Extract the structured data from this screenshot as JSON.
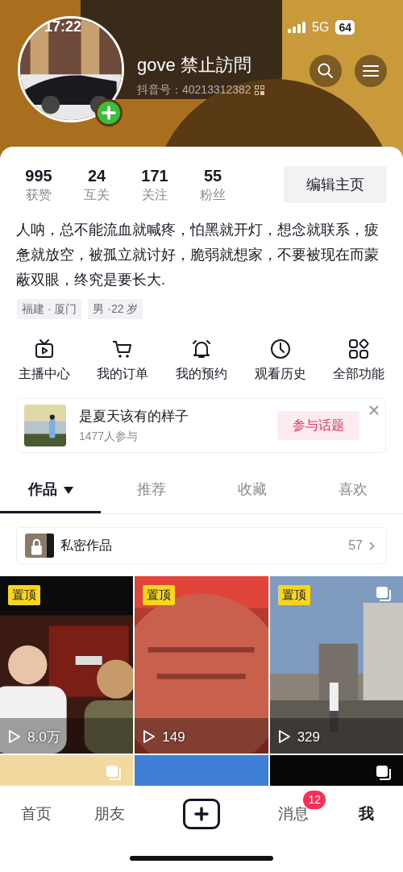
{
  "status_bar": {
    "time": "17:22",
    "network": "5G",
    "battery": "64"
  },
  "profile": {
    "name": "gove 禁止訪問",
    "id_label": "抖音号：",
    "id_value": "40213312382"
  },
  "stats": [
    {
      "value": "995",
      "label": "获赞"
    },
    {
      "value": "24",
      "label": "互关"
    },
    {
      "value": "171",
      "label": "关注"
    },
    {
      "value": "55",
      "label": "粉丝"
    }
  ],
  "edit_button": "编辑主页",
  "bio": "人呐，总不能流血就喊疼，怕黑就开灯，想念就联系，疲惫就放空，被孤立就讨好，脆弱就想家，不要被现在而蒙蔽双眼，终究是要长大.",
  "tags": [
    "福建 · 厦门",
    "男 ·22 岁"
  ],
  "shortcuts": [
    {
      "kind": "tv",
      "label": "主播中心"
    },
    {
      "kind": "cart",
      "label": "我的订单"
    },
    {
      "kind": "bell",
      "label": "我的预约"
    },
    {
      "kind": "clock",
      "label": "观看历史"
    },
    {
      "kind": "apps",
      "label": "全部功能"
    }
  ],
  "topic": {
    "title": "是夏天该有的样子",
    "participants": "1477人参与",
    "button": "参与话题"
  },
  "tabs": [
    {
      "label": "作品",
      "selected": true,
      "dropdown": true
    },
    {
      "label": "推荐",
      "selected": false,
      "dropdown": false
    },
    {
      "label": "收藏",
      "selected": false,
      "dropdown": false
    },
    {
      "label": "喜欢",
      "selected": false,
      "dropdown": false
    }
  ],
  "private_works": {
    "label": "私密作品",
    "count": "57"
  },
  "videos": [
    {
      "pinned": true,
      "pin_label": "置顶",
      "views": "8.0万",
      "multi": false
    },
    {
      "pinned": true,
      "pin_label": "置顶",
      "views": "149",
      "multi": false
    },
    {
      "pinned": true,
      "pin_label": "置顶",
      "views": "329",
      "multi": true
    },
    {
      "pinned": false,
      "multi": true
    },
    {
      "pinned": false,
      "multi": false
    },
    {
      "pinned": false,
      "multi": true
    }
  ],
  "bottom_nav": [
    {
      "kind": "text",
      "label": "首页",
      "selected": false
    },
    {
      "kind": "text",
      "label": "朋友",
      "selected": false
    },
    {
      "kind": "create",
      "selected": false
    },
    {
      "kind": "text",
      "label": "消息",
      "selected": false,
      "badge": "12"
    },
    {
      "kind": "text",
      "label": "我",
      "selected": true
    }
  ]
}
